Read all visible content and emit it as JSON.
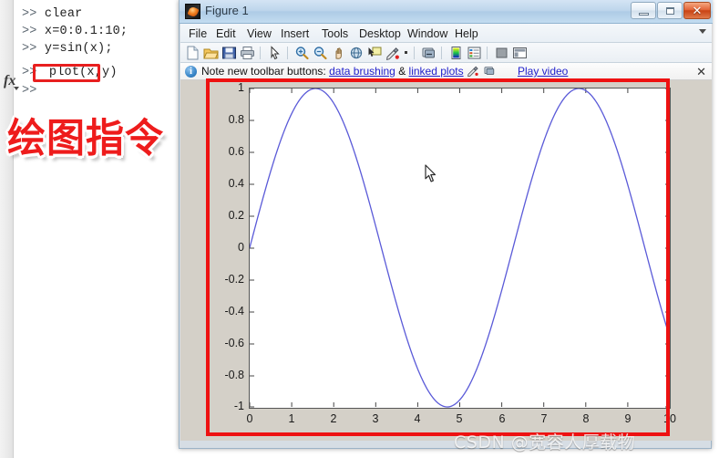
{
  "command_window": {
    "lines": [
      {
        "prompt": ">>",
        "text": "clear"
      },
      {
        "prompt": ">>",
        "text": "x=0:0.1:10;"
      },
      {
        "prompt": ">>",
        "text": "y=sin(x);"
      },
      {
        "prompt": ">>",
        "text": "plot(x,y)"
      },
      {
        "prompt": ">>",
        "text": ""
      }
    ],
    "fx_label": "fx"
  },
  "annotation": {
    "chinese_label": "绘图指令",
    "box_color": "#ee1111",
    "text_color": "#ee1c1c"
  },
  "figure_window": {
    "title": "Figure 1",
    "window_buttons": {
      "minimize": "–",
      "maximize": "❐",
      "close": "✕"
    },
    "menu": [
      "File",
      "Edit",
      "View",
      "Insert",
      "Tools",
      "Desktop",
      "Window",
      "Help"
    ],
    "toolbar": [
      {
        "name": "new-figure-icon",
        "tip": "New Figure"
      },
      {
        "name": "open-file-icon",
        "tip": "Open File"
      },
      {
        "name": "save-figure-icon",
        "tip": "Save Figure"
      },
      {
        "name": "print-figure-icon",
        "tip": "Print Figure"
      },
      {
        "name": "pointer-icon",
        "tip": "Edit Plot"
      },
      {
        "name": "zoom-in-icon",
        "tip": "Zoom In"
      },
      {
        "name": "zoom-out-icon",
        "tip": "Zoom Out"
      },
      {
        "name": "pan-icon",
        "tip": "Pan"
      },
      {
        "name": "rotate-3d-icon",
        "tip": "Rotate 3D"
      },
      {
        "name": "data-cursor-icon",
        "tip": "Data Cursor"
      },
      {
        "name": "brush-icon",
        "tip": "Brush/Select Data"
      },
      {
        "name": "link-plot-icon",
        "tip": "Link Plot"
      },
      {
        "name": "colorbar-icon",
        "tip": "Insert Colorbar"
      },
      {
        "name": "legend-icon",
        "tip": "Insert Legend"
      },
      {
        "name": "hide-plot-tools-icon",
        "tip": "Hide Plot Tools"
      },
      {
        "name": "show-plot-tools-icon",
        "tip": "Show Plot Tools"
      }
    ],
    "notification": {
      "lead": "Note new toolbar buttons:",
      "link1": "data brushing",
      "amp": "&",
      "link2": "linked plots",
      "play_link": "Play video",
      "close": "✕"
    }
  },
  "chart_data": {
    "type": "line",
    "title": "",
    "xlabel": "",
    "ylabel": "",
    "xlim": [
      0,
      10
    ],
    "ylim": [
      -1,
      1
    ],
    "xticks": [
      "0",
      "1",
      "2",
      "3",
      "4",
      "5",
      "6",
      "7",
      "8",
      "9",
      "10"
    ],
    "yticks": [
      "1",
      "0.8",
      "0.6",
      "0.4",
      "0.2",
      "0",
      "-0.2",
      "-0.4",
      "-0.6",
      "-0.8",
      "-1"
    ],
    "grid": false,
    "legend": null,
    "series": [
      {
        "name": "y = sin(x)",
        "color": "#5a5ad8",
        "expression": "sin(x)",
        "x_start": 0,
        "x_end": 10,
        "x_step": 0.1
      }
    ]
  },
  "watermark": {
    "text": "CSDN @宽容人厚载物"
  }
}
